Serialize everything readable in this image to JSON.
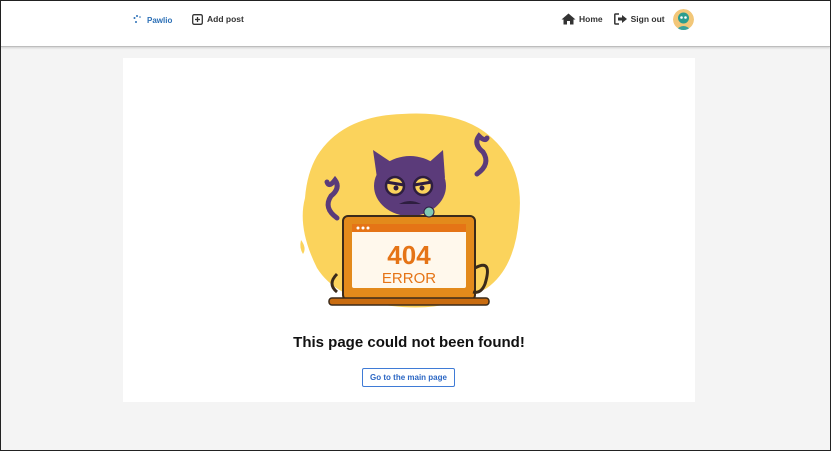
{
  "navbar": {
    "brand": "Pawlio",
    "add_post": "Add post",
    "home": "Home",
    "sign_out": "Sign out"
  },
  "error": {
    "code": "404",
    "word": "ERROR",
    "message": "This page could not been found!",
    "button": "Go to the main page"
  },
  "colors": {
    "brand": "#2b6fb6",
    "button_border": "#3f7bd6",
    "blob": "#fbd35c",
    "cat": "#5b3b7a",
    "error_orange": "#e57416"
  }
}
